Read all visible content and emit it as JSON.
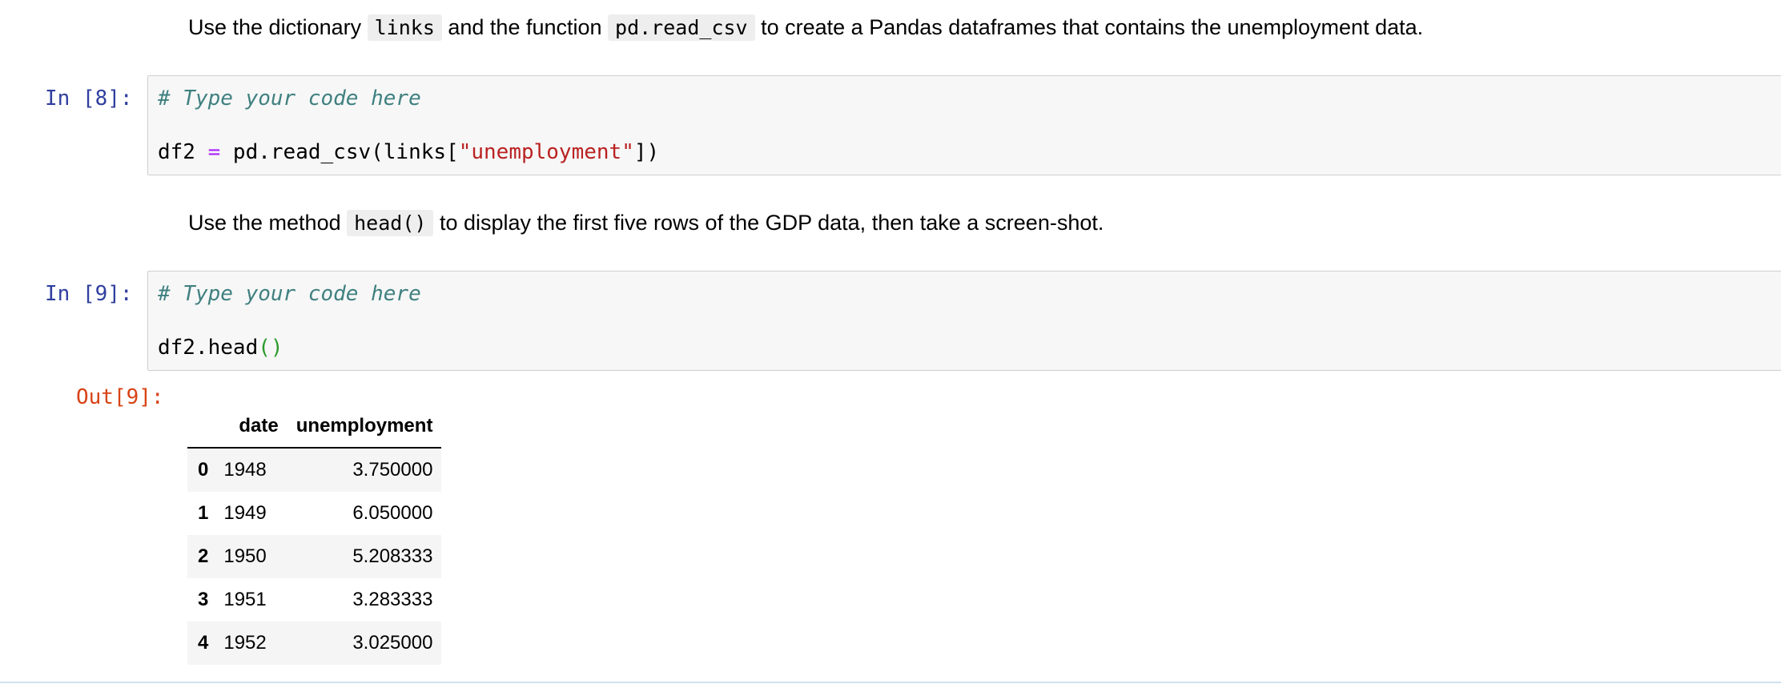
{
  "cells": {
    "md1": {
      "before": "Use the dictionary ",
      "code1": "links",
      "middle": " and the function ",
      "code2": "pd.read_csv",
      "after": " to create a Pandas dataframes that contains the unemployment data."
    },
    "in8": {
      "prompt": "In [8]:",
      "comment": "# Type your code here",
      "var": "df2 ",
      "op": "=",
      "call": " pd.read_csv(links[",
      "str": "\"unemployment\"",
      "close": "])"
    },
    "md2": {
      "before": "Use the method ",
      "code": "head()",
      "after": " to display the first five rows of the GDP data, then take a screen-shot."
    },
    "in9": {
      "prompt": "In [9]:",
      "comment": "# Type your code here",
      "call": "df2.head",
      "parens": "()"
    },
    "out9": {
      "prompt": "Out[9]:",
      "table": {
        "columns": [
          "date",
          "unemployment"
        ],
        "rows": [
          {
            "index": "0",
            "date": "1948",
            "unemployment": "3.750000"
          },
          {
            "index": "1",
            "date": "1949",
            "unemployment": "6.050000"
          },
          {
            "index": "2",
            "date": "1950",
            "unemployment": "5.208333"
          },
          {
            "index": "3",
            "date": "1951",
            "unemployment": "3.283333"
          },
          {
            "index": "4",
            "date": "1952",
            "unemployment": "3.025000"
          }
        ]
      }
    }
  }
}
